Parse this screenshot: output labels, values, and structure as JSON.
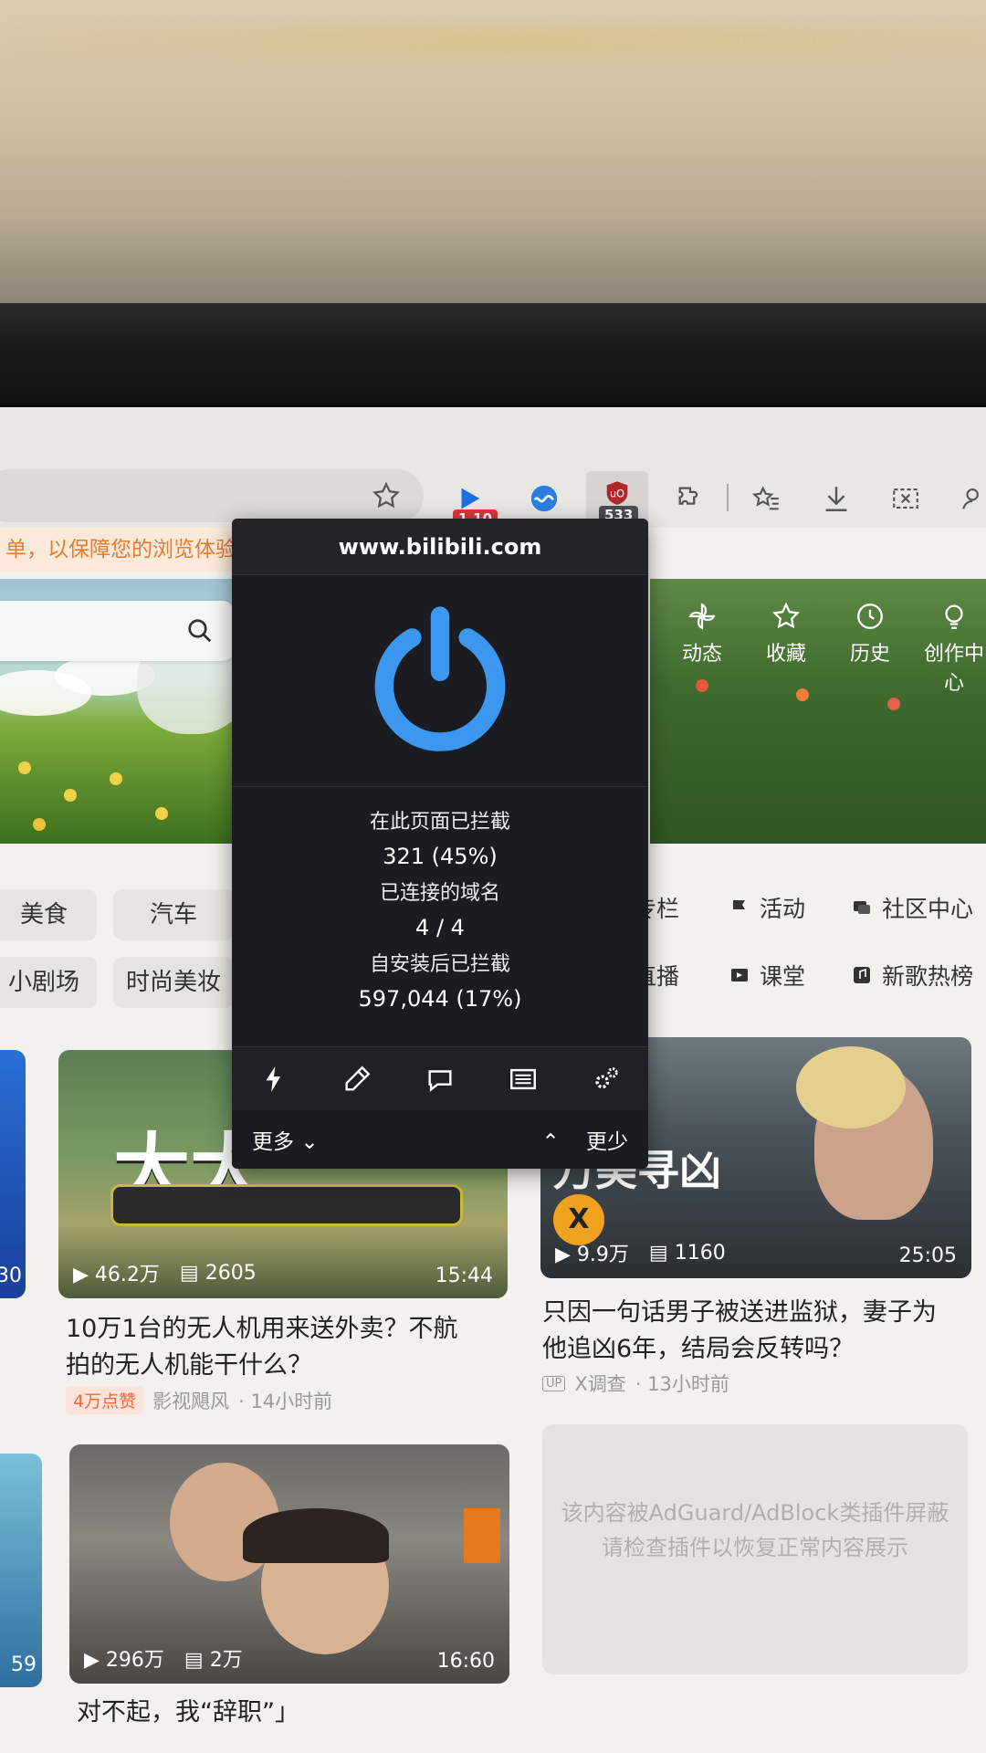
{
  "toolbar": {
    "ext_badge_1": "1.10",
    "ext_badge_ublock": "533"
  },
  "notice": {
    "text": "单，以保障您的浏览体验"
  },
  "top_nav": [
    {
      "label": "动态",
      "icon": "pinwheel-icon"
    },
    {
      "label": "收藏",
      "icon": "star-icon"
    },
    {
      "label": "历史",
      "icon": "clock-icon"
    },
    {
      "label": "创作中心",
      "icon": "bulb-icon"
    }
  ],
  "categories_left": [
    "美食",
    "汽车",
    "小剧场",
    "时尚美妆"
  ],
  "categories_right": [
    {
      "label": "专栏",
      "icon": "column-icon"
    },
    {
      "label": "活动",
      "icon": "flag-icon"
    },
    {
      "label": "社区中心",
      "icon": "community-icon"
    },
    {
      "label": "直播",
      "icon": "live-icon"
    },
    {
      "label": "课堂",
      "icon": "class-icon"
    },
    {
      "label": "新歌热榜",
      "icon": "music-icon"
    }
  ],
  "popup": {
    "hostname": "www.bilibili.com",
    "label_blocked_page": "在此页面已拦截",
    "value_blocked_page": "321 (45%)",
    "label_domains": "已连接的域名",
    "value_domains": "4 / 4",
    "label_blocked_total": "自安装后已拦截",
    "value_blocked_total": "597,044 (17%)",
    "more_label": "更多",
    "less_label": "更少",
    "power_color": "#3b97f0"
  },
  "videos": [
    {
      "thumb_text": "大大",
      "views": "46.2万",
      "danmaku": "2605",
      "duration": "15:44",
      "title_line1": "10万1台的无人机用来送外卖？不航",
      "title_line2": "拍的无人机能干什么？",
      "tag": "4万点赞",
      "author": "影视飓风",
      "time": "· 14小时前"
    },
    {
      "thumb_text": "万美寻凶",
      "views": "9.9万",
      "danmaku": "1160",
      "duration": "25:05",
      "title_line1": "只因一句话男子被送进监狱，妻子为",
      "title_line2": "他追凶6年，结局会反转吗？",
      "up_badge": "UP",
      "author": "X调查",
      "time": "· 13小时前"
    },
    {
      "views": "296万",
      "danmaku": "2万",
      "duration": "16:60",
      "title_line1": "对不起，我“辞职”」"
    }
  ],
  "left_edge": {
    "dur_1": "30",
    "dur_2": "59"
  },
  "blocked_card": {
    "line1": "该内容被AdGuard/AdBlock类插件屏蔽",
    "line2": "请检查插件以恢复正常内容展示"
  }
}
